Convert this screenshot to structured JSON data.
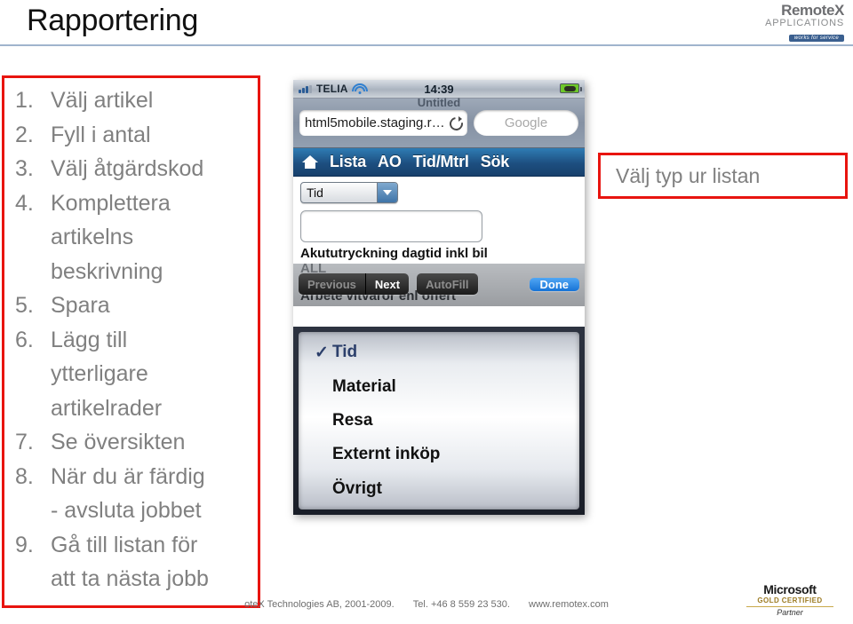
{
  "slide": {
    "title": "Rapportering"
  },
  "brand_logo": {
    "line1": "RemoteX",
    "line2": "APPLICATIONS",
    "tagline": "works for service"
  },
  "steps": [
    {
      "num": "1.",
      "text": "Välj artikel"
    },
    {
      "num": "2.",
      "text": "Fyll i antal"
    },
    {
      "num": "3.",
      "text": "Välj åtgärdskod"
    },
    {
      "num": "4.",
      "text": "Komplettera"
    },
    {
      "num": "",
      "text": "artikelns"
    },
    {
      "num": "",
      "text": "beskrivning"
    },
    {
      "num": "5.",
      "text": "Spara"
    },
    {
      "num": "6.",
      "text": "Lägg till"
    },
    {
      "num": "",
      "text": "ytterligare"
    },
    {
      "num": "",
      "text": "artikelrader"
    },
    {
      "num": "7.",
      "text": "Se översikten"
    },
    {
      "num": "8.",
      "text": "När du är färdig"
    },
    {
      "num": "",
      "text": "- avsluta jobbet"
    },
    {
      "num": "9.",
      "text": "Gå till listan för"
    },
    {
      "num": "",
      "text": "att ta nästa jobb"
    }
  ],
  "callout": {
    "text": "Välj typ ur listan",
    "border_color": "#e8140f"
  },
  "phone": {
    "statusbar": {
      "carrier": "TELIA",
      "time": "14:39",
      "signal_icon": "signal-bars-icon",
      "wifi_icon": "wifi-icon",
      "battery_icon": "battery-full-icon"
    },
    "browser": {
      "page_title": "Untitled",
      "url": "html5mobile.staging.r…",
      "reload_icon": "reload-icon",
      "search_placeholder": "Google"
    },
    "navbar": {
      "home_icon": "home-icon",
      "items": [
        "Lista",
        "AO",
        "Tid/Mtrl",
        "Sök"
      ],
      "background": "#1d4f80"
    },
    "form": {
      "select_value": "Tid",
      "dropdown_icon": "chevron-down-icon",
      "text_input_value": "",
      "article_label": "Akututryckning dagtid inkl bil"
    },
    "behind_rows": {
      "row1": "ALL",
      "row2": "Arbete vitvaror enl offert"
    },
    "keyboard_bar": {
      "previous": "Previous",
      "next": "Next",
      "autofill": "AutoFill",
      "done": "Done",
      "done_color": "#1673d6"
    },
    "picker": {
      "check_icon": "✓",
      "options": [
        {
          "label": "Tid",
          "selected": true
        },
        {
          "label": "Material",
          "selected": false
        },
        {
          "label": "Resa",
          "selected": false
        },
        {
          "label": "Externt inköp",
          "selected": false
        },
        {
          "label": "Övrigt",
          "selected": false
        }
      ]
    }
  },
  "footer": {
    "copyright": "oteX Technologies AB, 2001-2009.",
    "phone": "Tel. +46 8 559 23 530.",
    "website": "www.remotex.com"
  },
  "ms_logo": {
    "line1": "Microsoft",
    "line2": "GOLD CERTIFIED",
    "line3": "Partner"
  }
}
